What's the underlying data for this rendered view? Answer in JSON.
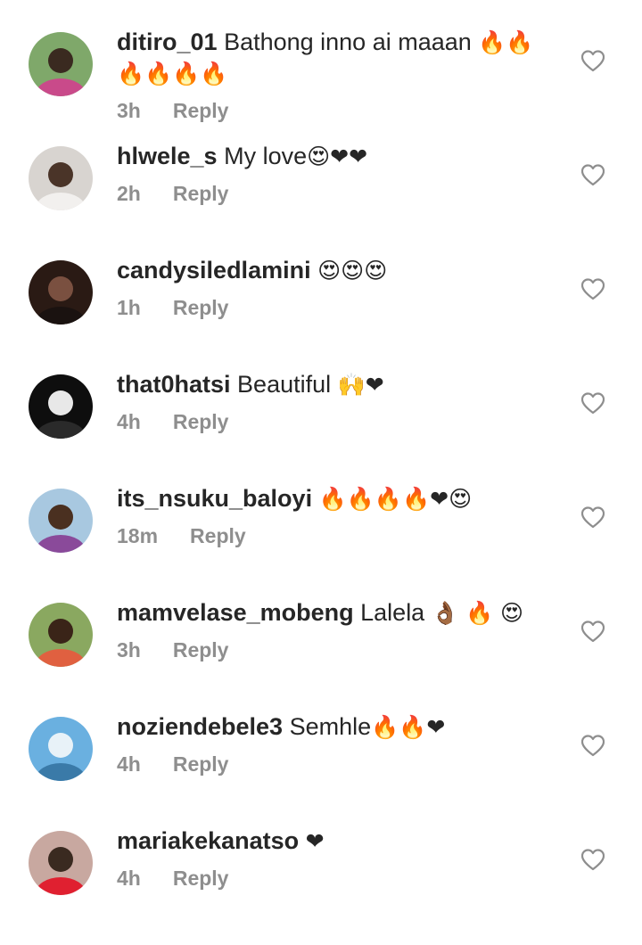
{
  "reply_label": "Reply",
  "comments": [
    {
      "username": "ditiro_01",
      "text": "Bathong inno ai maaan 🔥🔥🔥🔥🔥🔥",
      "time": "3h",
      "avatar_colors": [
        "#7fa86a",
        "#3a2a20",
        "#c94a8a"
      ]
    },
    {
      "username": "hlwele_s",
      "text": "My love😍❤❤",
      "time": "2h",
      "avatar_colors": [
        "#d8d4d0",
        "#4a3428",
        "#f2f0ee"
      ]
    },
    {
      "username": "candysiledlamini",
      "text": "😍😍😍",
      "time": "1h",
      "avatar_colors": [
        "#2a1a14",
        "#7a5040",
        "#1a1210"
      ]
    },
    {
      "username": "that0hatsi",
      "text": "Beautiful 🙌❤",
      "time": "4h",
      "avatar_colors": [
        "#0e0e0e",
        "#e8e8e8",
        "#2a2a2a"
      ]
    },
    {
      "username": "its_nsuku_baloyi",
      "text": "🔥🔥🔥🔥❤😍",
      "time": "18m",
      "avatar_colors": [
        "#a8c8e0",
        "#4a3020",
        "#8a4a9a"
      ]
    },
    {
      "username": "mamvelase_mobeng",
      "text": "Lalela 👌🏾 🔥 😍",
      "time": "3h",
      "avatar_colors": [
        "#8aa860",
        "#3a2418",
        "#e06040"
      ]
    },
    {
      "username": "noziendebele3",
      "text": "Semhle🔥🔥❤",
      "time": "4h",
      "avatar_colors": [
        "#6ab0e0",
        "#e8f2f8",
        "#3a7aa8"
      ]
    },
    {
      "username": "mariakekanatso",
      "text": "❤",
      "time": "4h",
      "avatar_colors": [
        "#c8a8a0",
        "#3a2a20",
        "#e02030"
      ]
    }
  ],
  "icons": {
    "like": "heart-outline-icon"
  }
}
